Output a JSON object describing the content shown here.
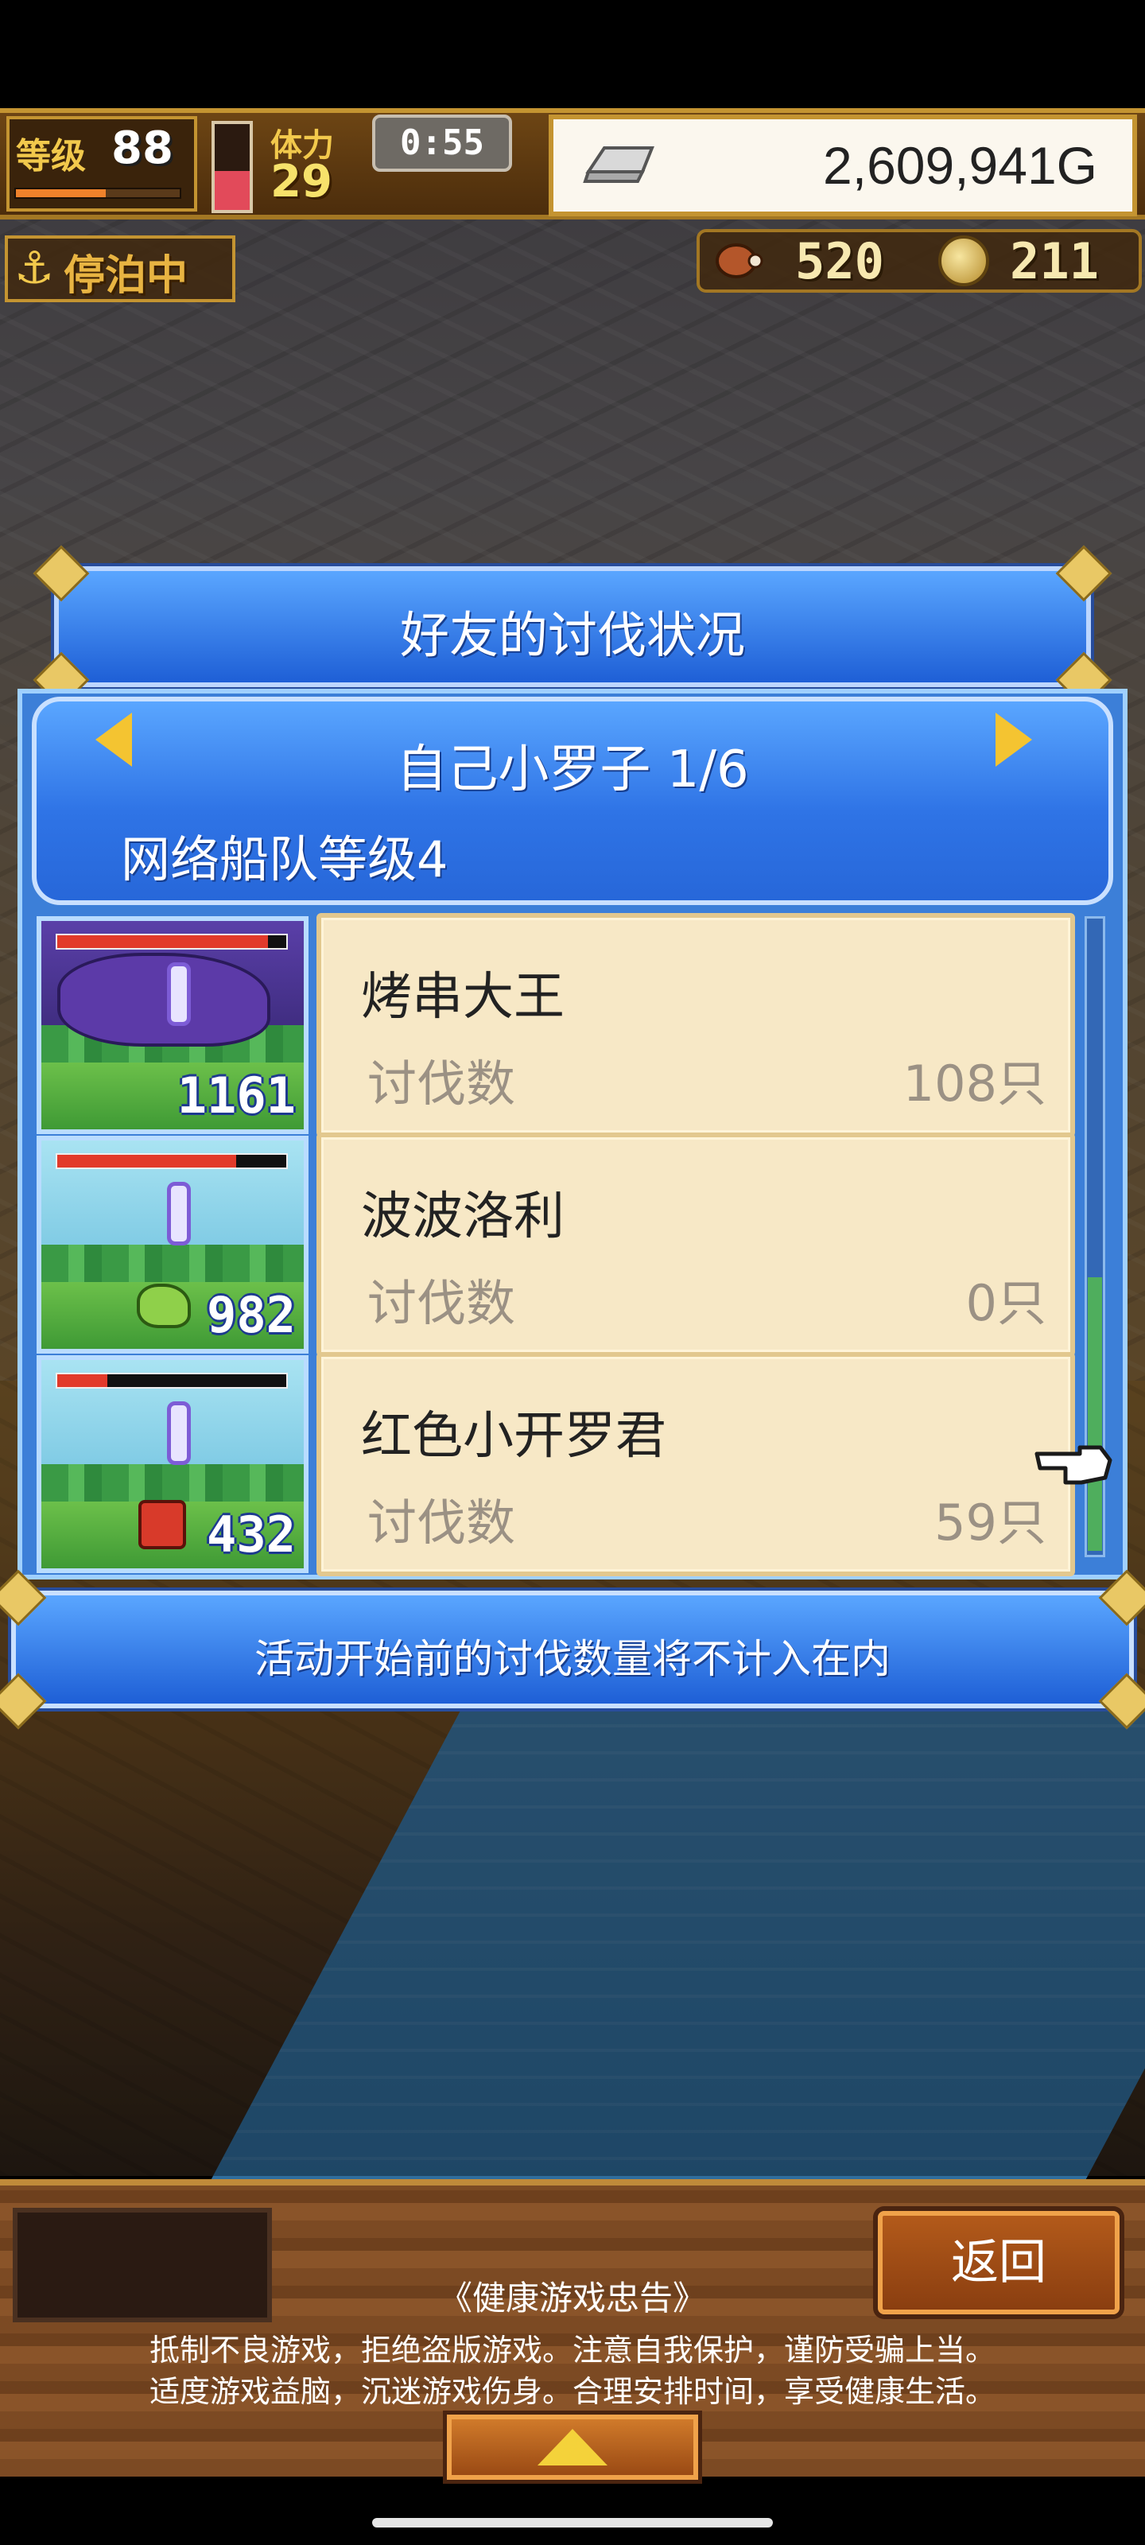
{
  "hud": {
    "level_label": "等级",
    "level": "88",
    "level_progress": 0.55,
    "hp_fill": 0.45,
    "stamina_label": "体力",
    "stamina": "29",
    "timer": "0:55",
    "gold_icon": "silver-ingot-icon",
    "gold": "2,609,941G",
    "status": "停泊中",
    "status_icon": "anchor-icon",
    "resource1_icon": "meat-icon",
    "resource1": "520",
    "resource2_icon": "medal-icon",
    "resource2": "211"
  },
  "dialog": {
    "title": "好友的讨伐状况",
    "friend_name": "自己小罗子 1/6",
    "fleet_level": "网络船队等级4",
    "rows": [
      {
        "name": "烤串大王",
        "kills_label": "讨伐数",
        "kills": "108只",
        "thumb_count": "1161",
        "thumb_hp": 0.92
      },
      {
        "name": "波波洛利",
        "kills_label": "讨伐数",
        "kills": "0只",
        "thumb_count": "982",
        "thumb_hp": 0.78
      },
      {
        "name": "红色小开罗君",
        "kills_label": "讨伐数",
        "kills": "59只",
        "thumb_count": "432",
        "thumb_hp": 0.22
      }
    ],
    "notice": "活动开始前的讨伐数量将不计入在内"
  },
  "footer": {
    "back_label": "返回",
    "health_title": "《健康游戏忠告》",
    "health_line1": "抵制不良游戏，拒绝盗版游戏。注意自我保护，谨防受骗上当。",
    "health_line2": "适度游戏益脑，沉迷游戏伤身。合理安排时间，享受健康生活。"
  },
  "colors": {
    "dialog_blue": "#2f74e6",
    "card_cream": "#f7e8c6",
    "gold_accent": "#c49431",
    "arrow_yellow": "#f4c431"
  }
}
